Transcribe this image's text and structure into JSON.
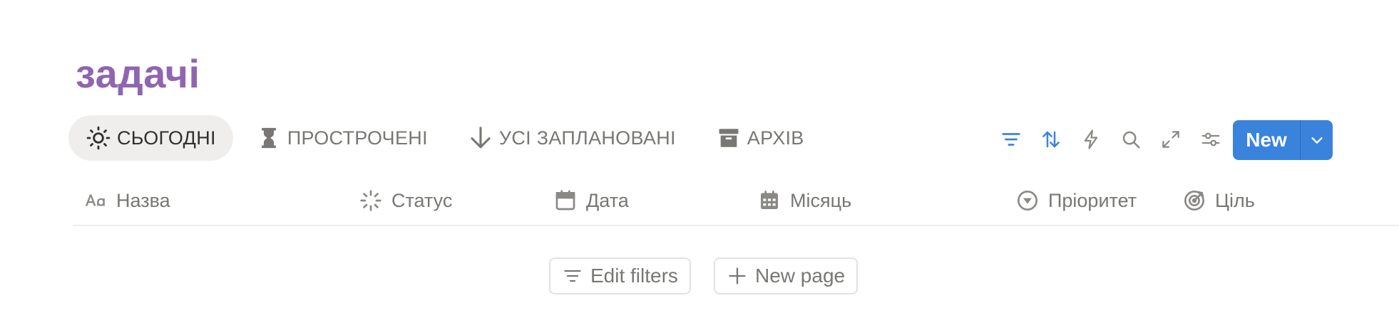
{
  "page": {
    "title": "задачі"
  },
  "tabs": [
    {
      "label": "СЬОГОДНІ",
      "icon": "sun-icon",
      "active": true
    },
    {
      "label": "ПРОСТРОЧЕНІ",
      "icon": "hourglass-icon",
      "active": false
    },
    {
      "label": "УСІ ЗАПЛАНОВАНІ",
      "icon": "arrow-down-icon",
      "active": false
    },
    {
      "label": "АРХІВ",
      "icon": "archive-box-icon",
      "active": false
    }
  ],
  "toolbar": {
    "tools": [
      "filter-icon",
      "sort-icon",
      "lightning-icon",
      "search-icon",
      "expand-icon",
      "sliders-icon"
    ],
    "new_label": "New",
    "accent_color": "#3a83dd"
  },
  "columns": [
    {
      "label": "Назва",
      "icon": "text-aa-icon"
    },
    {
      "label": "Статус",
      "icon": "status-spinner-icon"
    },
    {
      "label": "Дата",
      "icon": "calendar-icon"
    },
    {
      "label": "Місяць",
      "icon": "calendar-grid-icon"
    },
    {
      "label": "Пріоритет",
      "icon": "priority-select-icon"
    },
    {
      "label": "Ціль",
      "icon": "target-icon"
    }
  ],
  "empty_state": {
    "edit_filters_label": "Edit filters",
    "new_page_label": "New page"
  },
  "colors": {
    "title": "#9065b0",
    "muted_text": "#787774"
  }
}
